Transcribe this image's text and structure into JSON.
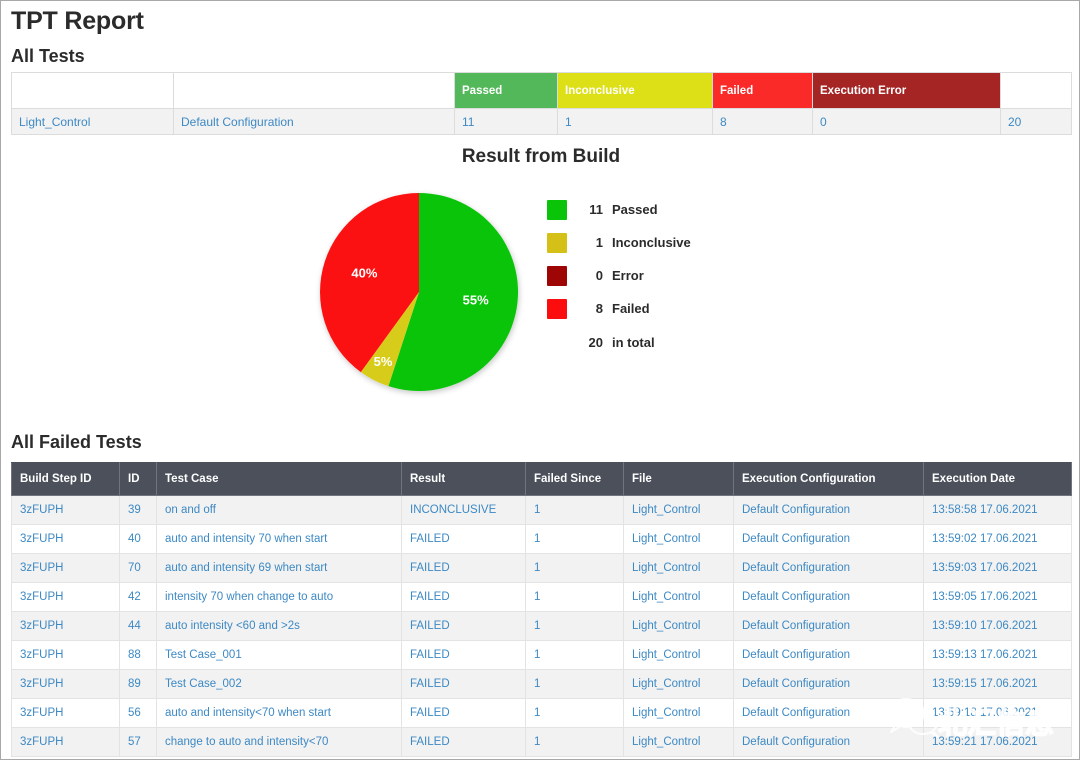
{
  "report": {
    "title": "TPT Report",
    "all_tests_heading": "All Tests",
    "all_failed_heading": "All Failed Tests"
  },
  "summary_table": {
    "headers": [
      "",
      "",
      "Passed",
      "Inconclusive",
      "Failed",
      "Execution Error",
      ""
    ],
    "header_colors": [
      "#ffffff",
      "#ffffff",
      "#53b85a",
      "#dde016",
      "#f92a28",
      "#a52525",
      "#ffffff"
    ],
    "row": {
      "name": "Light_Control",
      "configuration": "Default Configuration",
      "passed": "11",
      "inconclusive": "1",
      "failed": "8",
      "execution_error": "0",
      "total": "20"
    }
  },
  "chart_data": {
    "type": "pie",
    "title": "Result from Build",
    "categories": [
      "Passed",
      "Inconclusive",
      "Failed"
    ],
    "values": [
      11,
      1,
      8
    ],
    "percent_labels": [
      "55%",
      "5%",
      "40%"
    ],
    "slice_colors": [
      "#0ac40a",
      "#d8cc1a",
      "#fb1111"
    ],
    "start_angle_deg": 0,
    "direction": "clockwise",
    "legend_position": "right",
    "legend": [
      {
        "count": "11",
        "label": "Passed",
        "color": "#0ac40a"
      },
      {
        "count": "1",
        "label": "Inconclusive",
        "color": "#d4c017"
      },
      {
        "count": "0",
        "label": "Error",
        "color": "#9e0606"
      },
      {
        "count": "8",
        "label": "Failed",
        "color": "#fc0d0d"
      }
    ],
    "total": {
      "count": "20",
      "label": "in total"
    }
  },
  "failed_table": {
    "headers": [
      "Build Step ID",
      "ID",
      "Test Case",
      "Result",
      "Failed Since",
      "File",
      "Execution Configuration",
      "Execution Date"
    ],
    "rows": [
      {
        "build_step_id": "3zFUPH",
        "id": "39",
        "test_case": "on and off",
        "result": "INCONCLUSIVE",
        "failed_since": "1",
        "file": "Light_Control",
        "configuration": "Default Configuration",
        "date": "13:58:58 17.06.2021"
      },
      {
        "build_step_id": "3zFUPH",
        "id": "40",
        "test_case": "auto and intensity 70 when start",
        "result": "FAILED",
        "failed_since": "1",
        "file": "Light_Control",
        "configuration": "Default Configuration",
        "date": "13:59:02 17.06.2021"
      },
      {
        "build_step_id": "3zFUPH",
        "id": "70",
        "test_case": "auto and intensity 69 when start",
        "result": "FAILED",
        "failed_since": "1",
        "file": "Light_Control",
        "configuration": "Default Configuration",
        "date": "13:59:03 17.06.2021"
      },
      {
        "build_step_id": "3zFUPH",
        "id": "42",
        "test_case": "intensity 70 when change to auto",
        "result": "FAILED",
        "failed_since": "1",
        "file": "Light_Control",
        "configuration": "Default Configuration",
        "date": "13:59:05 17.06.2021"
      },
      {
        "build_step_id": "3zFUPH",
        "id": "44",
        "test_case": "auto intensity <60 and >2s",
        "result": "FAILED",
        "failed_since": "1",
        "file": "Light_Control",
        "configuration": "Default Configuration",
        "date": "13:59:10 17.06.2021"
      },
      {
        "build_step_id": "3zFUPH",
        "id": "88",
        "test_case": "Test Case_001",
        "result": "FAILED",
        "failed_since": "1",
        "file": "Light_Control",
        "configuration": "Default Configuration",
        "date": "13:59:13 17.06.2021"
      },
      {
        "build_step_id": "3zFUPH",
        "id": "89",
        "test_case": "Test Case_002",
        "result": "FAILED",
        "failed_since": "1",
        "file": "Light_Control",
        "configuration": "Default Configuration",
        "date": "13:59:15 17.06.2021"
      },
      {
        "build_step_id": "3zFUPH",
        "id": "56",
        "test_case": "auto and intensity<70 when start",
        "result": "FAILED",
        "failed_since": "1",
        "file": "Light_Control",
        "configuration": "Default Configuration",
        "date": "13:59:18 17.06.2021"
      },
      {
        "build_step_id": "3zFUPH",
        "id": "57",
        "test_case": "change to auto and intensity<70",
        "result": "FAILED",
        "failed_since": "1",
        "file": "Light_Control",
        "configuration": "Default Configuration",
        "date": "13:59:21 17.06.2021"
      }
    ]
  },
  "watermark": {
    "text": "北汇信息",
    "icon": "wechat-icon"
  }
}
